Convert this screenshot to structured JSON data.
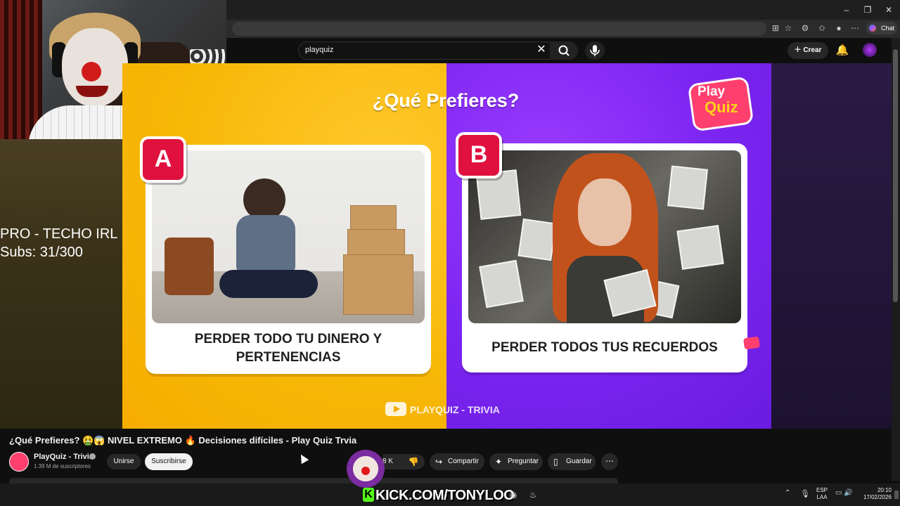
{
  "browser": {
    "chat_label": "Chat",
    "window_controls": [
      "minimize-icon",
      "restore-icon",
      "close-icon"
    ]
  },
  "youtube": {
    "search_value": "playquiz",
    "create_label": "Crear"
  },
  "stream_overlay": {
    "line1": "PRO - TECHO IRL",
    "line2": "Subs: 31/300"
  },
  "video": {
    "heading": "¿Qué Prefieres?",
    "logo_play": "Play",
    "logo_quiz": "Quiz",
    "option_a_letter": "A",
    "option_a_text": "PERDER TODO TU DINERO Y PERTENENCIAS",
    "option_b_letter": "B",
    "option_b_text": "PERDER TODOS TUS RECUERDOS",
    "watermark": "PLAYQUIZ - TRIVIA",
    "colors": {
      "left_bg": "#f7b808",
      "right_bg": "#7a24f0",
      "badge": "#e0103f"
    }
  },
  "watch": {
    "title": "¿Qué Prefieres? 🤮😱 NIVEL EXTREMO 🔥 Decisiones difíciles - Play Quiz Trvia",
    "channel_name": "PlayQuiz - Trivia",
    "subscribers": "1.39 M de suscriptores",
    "join_label": "Unirse",
    "subscribe_label": "Suscribirse",
    "like_count_fragment": "8 K",
    "share_label": "Compartir",
    "ask_label": "Preguntar",
    "save_label": "Guardar"
  },
  "taskbar": {
    "kick_label": "KICK.COM/TONYLOO",
    "lang_line1": "ESP",
    "lang_line2": "LAA",
    "time": "20:10",
    "date": "17/02/2026"
  }
}
